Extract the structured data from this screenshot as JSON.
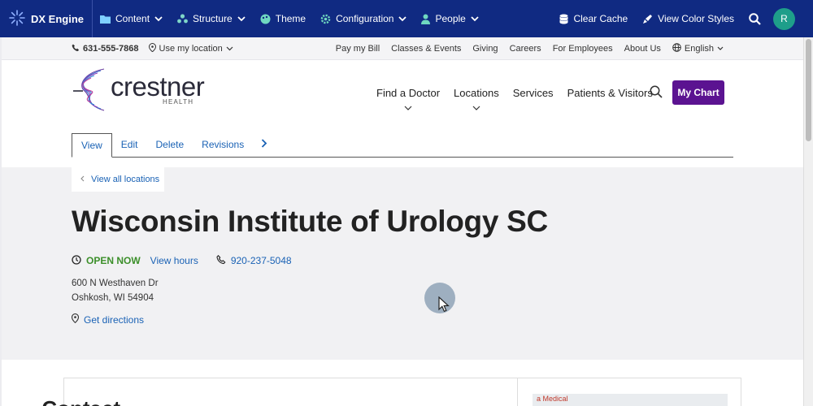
{
  "adminbar": {
    "brand": "DX Engine",
    "items": [
      {
        "label": "Content",
        "icon": "folder-icon",
        "has_menu": true
      },
      {
        "label": "Structure",
        "icon": "sitemap-icon",
        "has_menu": true
      },
      {
        "label": "Theme",
        "icon": "palette-icon",
        "has_menu": false
      },
      {
        "label": "Configuration",
        "icon": "gear-icon",
        "has_menu": true
      },
      {
        "label": "People",
        "icon": "person-icon",
        "has_menu": true
      }
    ],
    "clear_cache": "Clear Cache",
    "view_color_styles": "View Color Styles",
    "avatar_initial": "R",
    "colors": {
      "bar": "#102a82",
      "avatar": "#1e9e8a"
    }
  },
  "utility": {
    "phone": "631-555-7868",
    "location": "Use my location",
    "links": [
      "Pay my Bill",
      "Classes & Events",
      "Giving",
      "Careers",
      "For Employees",
      "About Us"
    ],
    "language": "English"
  },
  "header": {
    "logo_text": "crestner",
    "logo_sub": "HEALTH",
    "nav": [
      "Find a Doctor",
      "Locations",
      "Services",
      "Patients & Visitors"
    ],
    "my_chart": "My Chart",
    "accent": "#5b1391"
  },
  "tabs": [
    "View",
    "Edit",
    "Delete",
    "Revisions"
  ],
  "location": {
    "back_link": "View all locations",
    "title": "Wisconsin Institute of Urology SC",
    "status": "OPEN NOW",
    "view_hours": "View hours",
    "phone": "920-237-5048",
    "address_line1": "600 N Westhaven Dr",
    "address_line2": "Oshkosh, WI 54904",
    "directions": "Get directions"
  },
  "below": {
    "heading_partial": "Contact",
    "map_label": "a Medical"
  }
}
